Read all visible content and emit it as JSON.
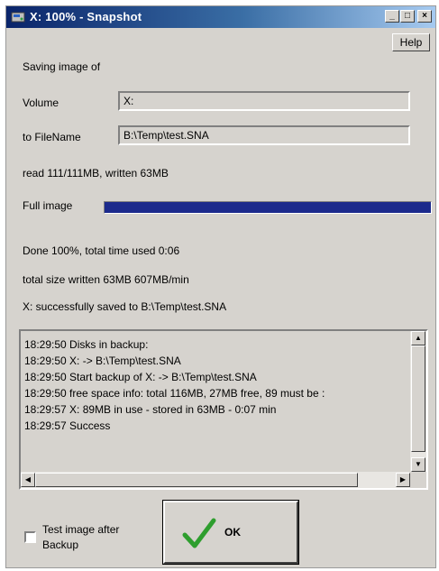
{
  "window": {
    "title": "X: 100% - Snapshot",
    "minimize_glyph": "_",
    "maximize_glyph": "□",
    "close_glyph": "×",
    "help_label": "Help"
  },
  "form": {
    "heading": "Saving image of",
    "volume_label": "Volume",
    "volume_value": "X:",
    "filename_label": "to FileName",
    "filename_value": "B:\\Temp\\test.SNA",
    "read_status": "read 111/111MB, written 63MB",
    "progress_label": "Full image",
    "progress_percent": 100
  },
  "status": {
    "done": "Done 100%, total time used  0:06",
    "size": "total size written 63MB 607MB/min",
    "saved": "X: successfully saved to B:\\Temp\\test.SNA"
  },
  "log": {
    "lines": [
      "18:29:50 Disks in backup:",
      "18:29:50     X: -> B:\\Temp\\test.SNA",
      "18:29:50 Start backup of X: -> B:\\Temp\\test.SNA",
      "18:29:50 free space info: total 116MB, 27MB free, 89 must be :",
      "18:29:57 X:          89MB in use - stored in          63MB - 0:07 min",
      "18:29:57 Success"
    ]
  },
  "footer": {
    "checkbox_label_line1": "Test image after",
    "checkbox_label_line2": "Backup",
    "checkbox_checked": false,
    "ok_label": "OK"
  },
  "colors": {
    "progress_fill": "#1c2a8c",
    "ok_check": "#2e9e2e",
    "titlebar_start": "#0a246a"
  }
}
